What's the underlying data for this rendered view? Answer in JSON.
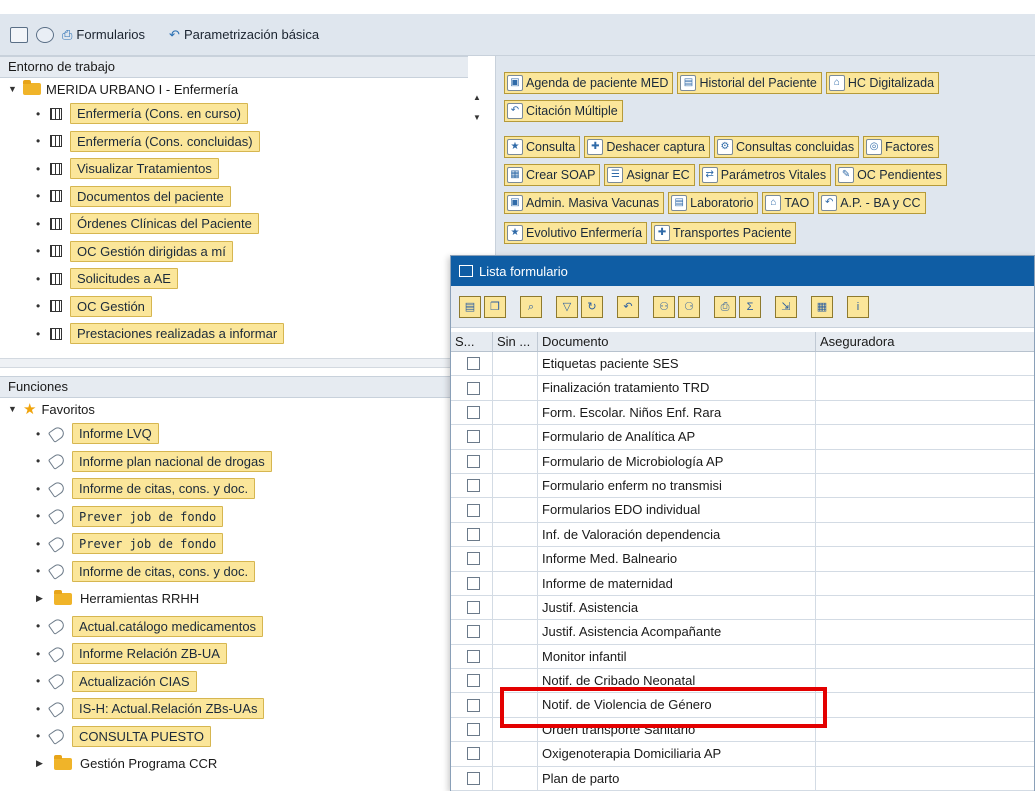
{
  "menubar": {
    "items": [
      {
        "label": "Formularios",
        "icon": "printer-icon"
      },
      {
        "label": "Parametrización básica",
        "icon": "undo-icon"
      }
    ]
  },
  "workspace": {
    "header": "Entorno de trabajo",
    "root": "MERIDA URBANO I - Enfermería",
    "items": [
      "Enfermería  (Cons. en curso)",
      "Enfermería (Cons. concluidas)",
      "Visualizar Tratamientos",
      "Documentos del paciente",
      "Órdenes Clínicas del Paciente",
      "OC Gestión dirigidas a mí",
      "Solicitudes a AE",
      "OC Gestión",
      "Prestaciones realizadas a informar"
    ]
  },
  "functions": {
    "header": "Funciones",
    "favorites_label": "Favoritos",
    "items": [
      {
        "label": "Informe LVQ",
        "type": "item"
      },
      {
        "label": "Informe plan nacional de drogas",
        "type": "item"
      },
      {
        "label": "Informe de citas, cons. y doc.",
        "type": "item"
      },
      {
        "label": "Prever job de fondo",
        "type": "item"
      },
      {
        "label": "Prever job de fondo",
        "type": "item"
      },
      {
        "label": "Informe de citas, cons. y doc.",
        "type": "item"
      },
      {
        "label": "Herramientas RRHH",
        "type": "folder"
      },
      {
        "label": "Actual.catálogo medicamentos",
        "type": "item"
      },
      {
        "label": "Informe Relación ZB-UA",
        "type": "item"
      },
      {
        "label": "Actualización CIAS",
        "type": "item"
      },
      {
        "label": "IS-H: Actual.Relación ZBs-UAs",
        "type": "item"
      },
      {
        "label": "CONSULTA PUESTO",
        "type": "item"
      },
      {
        "label": "Gestión Programa CCR",
        "type": "folder"
      }
    ]
  },
  "toolbar_rows": [
    [
      "Agenda de paciente MED",
      "Historial del Paciente",
      "HC Digitalizada"
    ],
    [
      "Citación Múltiple"
    ],
    [
      "Consulta",
      "Deshacer captura",
      "Consultas concluidas",
      "Factores"
    ],
    [
      "Crear SOAP",
      "Asignar EC",
      "Parámetros Vitales",
      "OC Pendientes"
    ],
    [
      "Admin. Masiva Vacunas",
      "Laboratorio",
      "TAO",
      "A.P. - BA y CC"
    ],
    [
      "Evolutivo Enfermería",
      "Transportes Paciente"
    ]
  ],
  "dialog": {
    "title": "Lista formulario",
    "columns": [
      "S...",
      "Sin ...",
      "Documento",
      "Aseguradora"
    ],
    "rows": [
      "Etiquetas paciente SES",
      "Finalización tratamiento TRD",
      "Form. Escolar. Niños Enf. Rara",
      "Formulario de Analítica AP",
      "Formulario de Microbiología AP",
      "Formulario enferm no transmisi",
      "Formularios EDO individual",
      "Inf. de Valoración dependencia",
      "Informe Med. Balneario",
      "Informe de maternidad",
      "Justif. Asistencia",
      "Justif. Asistencia Acompañante",
      "Monitor infantil",
      "Notif. de Cribado Neonatal",
      "Notif. de Violencia de Género",
      "Orden transporte Sanitario",
      "Oxigenoterapia Domiciliaria AP",
      "Plan de parto"
    ]
  },
  "colors": {
    "highlight_button": "#fbe69a",
    "title_bar": "#0f5da4",
    "annotation_box": "#e30000"
  }
}
